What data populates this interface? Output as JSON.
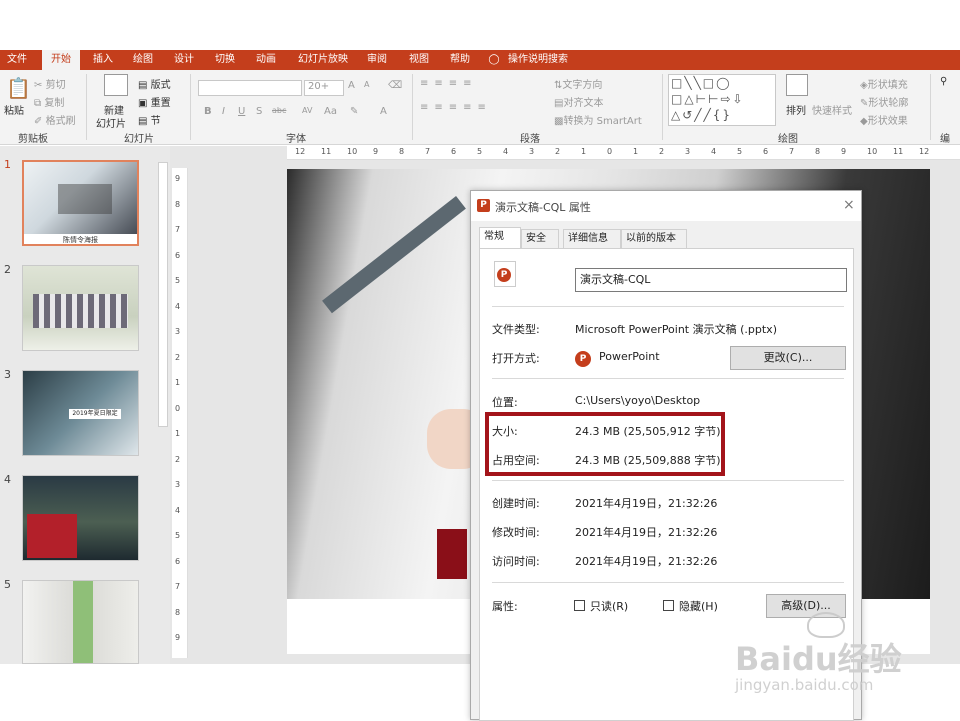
{
  "ribbon_tabs": [
    "文件",
    "开始",
    "插入",
    "绘图",
    "设计",
    "切换",
    "动画",
    "幻灯片放映",
    "审阅",
    "视图",
    "帮助",
    "操作说明搜索"
  ],
  "clipboard": {
    "paste": "粘贴",
    "cut": "剪切",
    "copy": "复制",
    "format_painter": "格式刷",
    "group": "剪贴板"
  },
  "slides_group": {
    "new_slide_1": "新建",
    "new_slide_2": "幻灯片",
    "layout": "版式",
    "reset": "重置",
    "section": "节",
    "group": "幻灯片"
  },
  "font_group": {
    "size": "20+",
    "group": "字体",
    "bold": "B",
    "italic": "I",
    "underline": "U",
    "shadow": "S",
    "strike": "abc",
    "spacing": "AV",
    "case": "Aa",
    "font_color": "A",
    "grow": "A",
    "shrink": "A"
  },
  "paragraph_group": {
    "text_direction": "文字方向",
    "align_text": "对齐文本",
    "smartart": "转换为 SmartArt",
    "group": "段落"
  },
  "drawing_group": {
    "arrange": "排列",
    "quick_styles": "快速样式",
    "shape_fill": "形状填充",
    "shape_outline": "形状轮廓",
    "shape_effects": "形状效果",
    "group": "绘图"
  },
  "editing_group": {
    "group": "编"
  },
  "h_ruler": [
    "12",
    "11",
    "10",
    "9",
    "8",
    "7",
    "6",
    "5",
    "4",
    "3",
    "2",
    "1",
    "0",
    "1",
    "2",
    "3",
    "4",
    "5",
    "6",
    "7",
    "8",
    "9",
    "10",
    "11",
    "12"
  ],
  "v_ruler": [
    "9",
    "8",
    "7",
    "6",
    "5",
    "4",
    "3",
    "2",
    "1",
    "0",
    "1",
    "2",
    "3",
    "4",
    "5",
    "6",
    "7",
    "8",
    "9"
  ],
  "slides": [
    {
      "number": "1",
      "caption": "陈情令海报"
    },
    {
      "number": "2"
    },
    {
      "number": "3",
      "caption": "2019年夏日限定"
    },
    {
      "number": "4"
    },
    {
      "number": "5"
    }
  ],
  "dialog": {
    "title": "演示文稿-CQL 属性",
    "tabs": [
      "常规",
      "安全",
      "详细信息",
      "以前的版本"
    ],
    "filename": "演示文稿-CQL",
    "rows": {
      "file_type_label": "文件类型:",
      "file_type_value": "Microsoft PowerPoint 演示文稿 (.pptx)",
      "opens_with_label": "打开方式:",
      "opens_with_value": "PowerPoint",
      "change_button": "更改(C)...",
      "location_label": "位置:",
      "location_value": "C:\\Users\\yoyo\\Desktop",
      "size_label": "大小:",
      "size_value": "24.3 MB (25,505,912 字节)",
      "disk_label": "占用空间:",
      "disk_value": "24.3 MB (25,509,888 字节)",
      "created_label": "创建时间:",
      "created_value": "2021年4月19日，21:32:26",
      "modified_label": "修改时间:",
      "modified_value": "2021年4月19日，21:32:26",
      "accessed_label": "访问时间:",
      "accessed_value": "2021年4月19日，21:32:26",
      "attributes_label": "属性:",
      "readonly_label": "只读(R)",
      "hidden_label": "隐藏(H)",
      "advanced_button": "高级(D)..."
    }
  },
  "watermark": {
    "brand": "Baidu经验",
    "url": "jingyan.baidu.com"
  },
  "colors": {
    "accent": "#c43e1c",
    "highlight": "#a3141a"
  }
}
